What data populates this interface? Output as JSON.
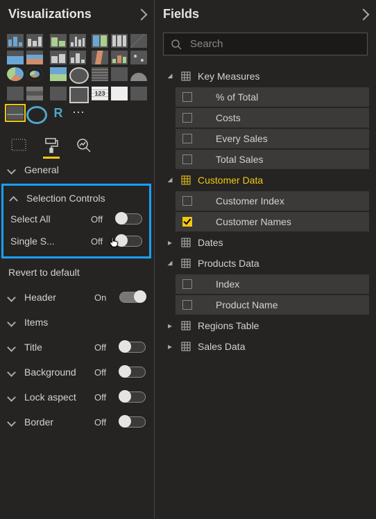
{
  "viz_panel": {
    "title": "Visualizations",
    "tabs": {
      "fields": "fields-tab",
      "format": "format-tab",
      "analytics": "analytics-tab"
    },
    "active_tab": "format",
    "gallery_more": "⋯",
    "format": {
      "general": {
        "label": "General"
      },
      "selection_controls": {
        "label": "Selection Controls",
        "select_all": {
          "label": "Select All",
          "state": "Off"
        },
        "single_select": {
          "label": "Single S...",
          "state": "Off"
        }
      },
      "revert": "Revert to default",
      "header": {
        "label": "Header",
        "state": "On"
      },
      "items": {
        "label": "Items"
      },
      "title": {
        "label": "Title",
        "state": "Off"
      },
      "background": {
        "label": "Background",
        "state": "Off"
      },
      "lock_aspect": {
        "label": "Lock aspect",
        "state": "Off"
      },
      "border": {
        "label": "Border",
        "state": "Off"
      }
    }
  },
  "fields_panel": {
    "title": "Fields",
    "search_placeholder": "Search",
    "tables": [
      {
        "name": "Key Measures",
        "expanded": true,
        "highlight": false,
        "children": [
          {
            "name": "% of Total",
            "checked": false
          },
          {
            "name": "Costs",
            "checked": false
          },
          {
            "name": "Every Sales",
            "checked": false
          },
          {
            "name": "Total Sales",
            "checked": false
          }
        ]
      },
      {
        "name": "Customer Data",
        "expanded": true,
        "highlight": true,
        "children": [
          {
            "name": "Customer Index",
            "checked": false
          },
          {
            "name": "Customer Names",
            "checked": true
          }
        ]
      },
      {
        "name": "Dates",
        "expanded": false,
        "highlight": false,
        "children": []
      },
      {
        "name": "Products Data",
        "expanded": true,
        "highlight": false,
        "children": [
          {
            "name": "Index",
            "checked": false
          },
          {
            "name": "Product Name",
            "checked": false
          }
        ]
      },
      {
        "name": "Regions Table",
        "expanded": false,
        "highlight": false,
        "children": []
      },
      {
        "name": "Sales Data",
        "expanded": false,
        "highlight": false,
        "children": []
      }
    ]
  }
}
